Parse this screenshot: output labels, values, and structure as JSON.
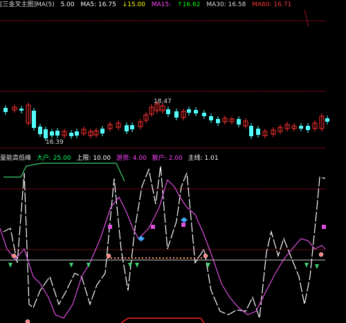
{
  "main_header": {
    "title": "[三金叉主图]MA(5)",
    "items": [
      {
        "text": "5.00",
        "color": "#ffffff"
      },
      {
        "text": "MA5: 16.75",
        "color": "#ffffff"
      },
      {
        "text": "↓15.00",
        "color": "#ffff00"
      },
      {
        "text": "MA15:",
        "color": "#ff44ff"
      },
      {
        "text": "↑16.62",
        "color": "#00ff00"
      },
      {
        "text": "MA30: 16.58",
        "color": "#dddddd"
      },
      {
        "text": "MA60: 16.71",
        "color": "#ff3333"
      }
    ]
  },
  "price_annotations": {
    "high": "18.47",
    "low": "16.39"
  },
  "indicator_header": {
    "items": [
      {
        "text": "量能高低峰",
        "color": "#dddddd"
      },
      {
        "text": "大户: 25.00",
        "color": "#00ff66"
      },
      {
        "text": "上限: 10.00",
        "color": "#ffffff"
      },
      {
        "text": "游资: 4.00",
        "color": "#ff44ff"
      },
      {
        "text": "散户: 2.00",
        "color": "#ff44ff"
      },
      {
        "text": "主线: 1.01",
        "color": "#ffffff"
      }
    ]
  },
  "colors": {
    "up_candle": "#ff3232",
    "down_candle": "#54fcfc",
    "red_line": "#a01020",
    "magenta": "#e050e0",
    "green": "#40d070",
    "white": "#ffffff"
  }
}
